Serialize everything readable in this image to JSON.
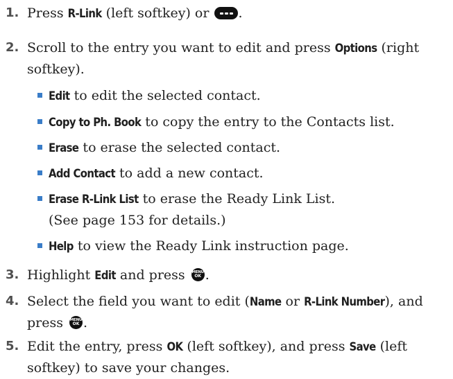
{
  "steps": [
    {
      "num": "1.",
      "t1": "Press ",
      "b1": "R-Link",
      "t2": " (left softkey) or ",
      "t3": "."
    },
    {
      "num": "2.",
      "t1": "Scroll to the entry you want to edit and press ",
      "b1": "Options",
      "t2": " (right",
      "line2": "softkey)."
    },
    {
      "num": "3.",
      "t1": "Highlight ",
      "b1": "Edit",
      "t2": " and press ",
      "t3": "."
    },
    {
      "num": "4.",
      "t1": "Select the field you want to edit (",
      "b1": "Name",
      "t2": " or ",
      "b2": "R-Link Number",
      "t3": "), and",
      "line2a": "press ",
      "line2b": "."
    },
    {
      "num": "5.",
      "t1": "Edit the entry, press ",
      "b1": "OK",
      "t2": " (left softkey), and press ",
      "b2": "Save",
      "t3": " (left",
      "line2": "softkey) to save your changes."
    }
  ],
  "options": [
    {
      "label": "Edit",
      "desc": " to edit the selected contact."
    },
    {
      "label": "Copy to Ph. Book",
      "desc": " to copy the entry to the Contacts list."
    },
    {
      "label": "Erase",
      "desc": " to erase the selected contact."
    },
    {
      "label": "Add Contact",
      "desc": " to add a new contact."
    },
    {
      "label": "Erase R-Link List",
      "desc": " to erase the Ready Link List.",
      "line2": "(See page 153 for details.)"
    },
    {
      "label": "Help",
      "desc": " to view the Ready Link instruction page."
    }
  ],
  "icons": {
    "menu_ok_top": "MENU",
    "menu_ok_bottom": "OK",
    "softkey_icon": "ellipsis-key-icon",
    "menu_icon": "menu-ok-key-icon",
    "bullet_color": "#3a7dc8"
  }
}
